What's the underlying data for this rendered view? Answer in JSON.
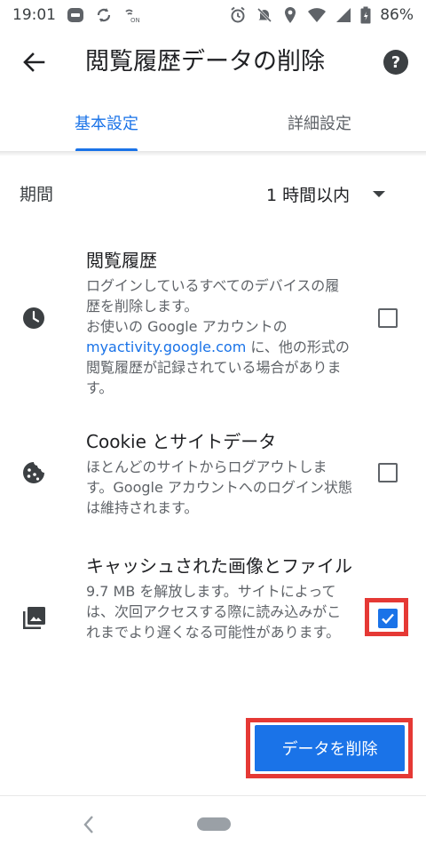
{
  "status_bar": {
    "time": "19:01",
    "battery": "86%",
    "left_icons": [
      "line-icon",
      "sync-icon",
      "wifi-calling-icon"
    ],
    "right_icons": [
      "alarm-icon",
      "mute-icon",
      "location-icon",
      "wifi-icon",
      "signal-icon",
      "battery-icon"
    ]
  },
  "app_bar": {
    "title": "閲覧履歴データの削除",
    "back_icon": "arrow-back-icon",
    "help_icon": "help-icon",
    "help_label": "?"
  },
  "tabs": [
    {
      "label": "基本設定",
      "active": true
    },
    {
      "label": "詳細設定",
      "active": false
    }
  ],
  "period": {
    "label": "期間",
    "value": "1 時間以内"
  },
  "options": [
    {
      "icon": "clock-icon",
      "title": "閲覧履歴",
      "desc": "ログインしているすべてのデバイスの履歴を削除します。",
      "desc2_pre": "お使いの Google アカウントの",
      "link": "myactivity.google.com",
      "desc2_post": " に、他の形式の閲覧履歴が記録されている場合があります。",
      "checked": false
    },
    {
      "icon": "cookie-icon",
      "title": "Cookie とサイトデータ",
      "desc": "ほとんどのサイトからログアウトします。Google アカウントへのログイン状態は維持されます。",
      "checked": false
    },
    {
      "icon": "image-icon",
      "title": "キャッシュされた画像とファイル",
      "desc": "9.7 MB を解放します。サイトによっては、次回アクセスする際に読み込みがこれまでより遅くなる可能性があります。",
      "checked": true
    }
  ],
  "primary_button": {
    "label": "データを削除"
  },
  "colors": {
    "accent": "#1a73e8",
    "highlight": "#e53935"
  }
}
